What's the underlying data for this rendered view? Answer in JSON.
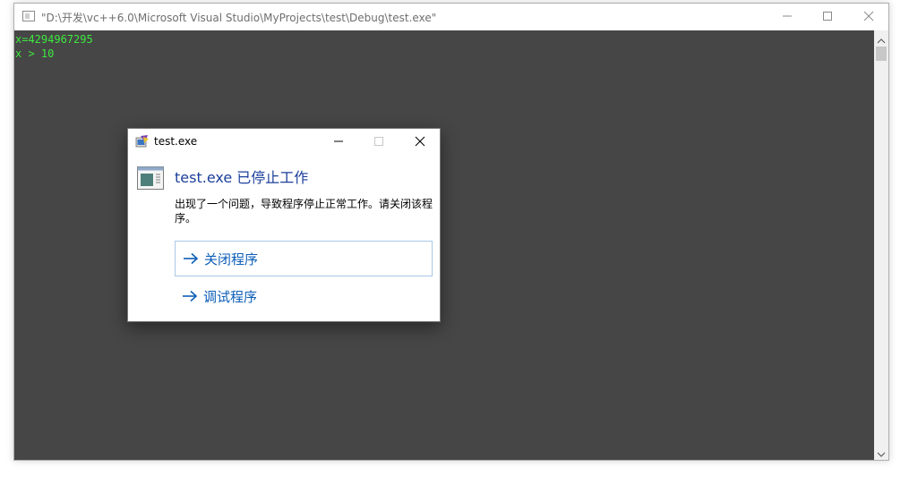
{
  "window": {
    "title": "\"D:\\开发\\vc++6.0\\Microsoft Visual Studio\\MyProjects\\test\\Debug\\test.exe\"",
    "icon": "console-app-icon"
  },
  "console": {
    "lines": [
      "x=4294967295",
      "x > 10"
    ],
    "text_color": "#3ee83e",
    "background": "#464646"
  },
  "dialog": {
    "title": "test.exe",
    "heading": "test.exe 已停止工作",
    "message": "出现了一个问题，导致程序停止正常工作。请关闭该程序。",
    "options": [
      {
        "label": "关闭程序"
      },
      {
        "label": "调试程序"
      }
    ],
    "heading_color": "#1b3f9a",
    "link_color": "#0c5eb8"
  }
}
